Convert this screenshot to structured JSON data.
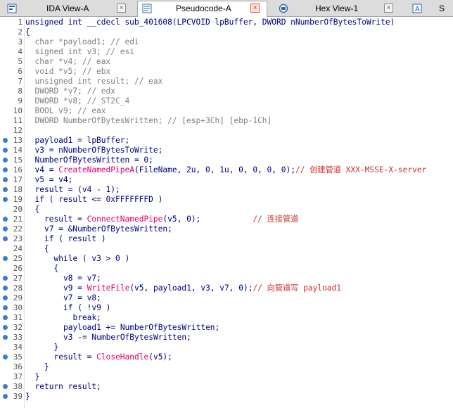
{
  "tabs": [
    {
      "label": "IDA View-A",
      "icon": "ida-view-icon",
      "active": false
    },
    {
      "label": "Pseudocode-A",
      "icon": "pseudocode-icon",
      "active": true
    },
    {
      "label": "Hex View-1",
      "icon": "hex-view-icon",
      "active": false
    },
    {
      "label": "S",
      "icon": "structures-icon",
      "active": false
    }
  ],
  "close_glyph": "×",
  "code_lines": [
    {
      "n": "1",
      "dot": false,
      "indent": 0,
      "segs": [
        {
          "t": "unsigned int __cdecl sub_401608(LPCVOID lpBuffer, DWORD nNumberOfBytesToWrite)",
          "c": "n"
        }
      ]
    },
    {
      "n": "2",
      "dot": false,
      "indent": 0,
      "segs": [
        {
          "t": "{",
          "c": "n"
        }
      ]
    },
    {
      "n": "3",
      "dot": false,
      "indent": 2,
      "segs": [
        {
          "t": "char *payload1; // edi",
          "c": "c"
        }
      ]
    },
    {
      "n": "4",
      "dot": false,
      "indent": 2,
      "segs": [
        {
          "t": "signed int v3; // esi",
          "c": "c"
        }
      ]
    },
    {
      "n": "5",
      "dot": false,
      "indent": 2,
      "segs": [
        {
          "t": "char *v4; // eax",
          "c": "c"
        }
      ]
    },
    {
      "n": "6",
      "dot": false,
      "indent": 2,
      "segs": [
        {
          "t": "void *v5; // ebx",
          "c": "c"
        }
      ]
    },
    {
      "n": "7",
      "dot": false,
      "indent": 2,
      "segs": [
        {
          "t": "unsigned int result; // eax",
          "c": "c"
        }
      ]
    },
    {
      "n": "8",
      "dot": false,
      "indent": 2,
      "segs": [
        {
          "t": "DWORD *v7; // edx",
          "c": "c"
        }
      ]
    },
    {
      "n": "9",
      "dot": false,
      "indent": 2,
      "segs": [
        {
          "t": "DWORD *v8; // ST2C_4",
          "c": "c"
        }
      ]
    },
    {
      "n": "10",
      "dot": false,
      "indent": 2,
      "segs": [
        {
          "t": "BOOL v9; // eax",
          "c": "c"
        }
      ]
    },
    {
      "n": "11",
      "dot": false,
      "indent": 2,
      "segs": [
        {
          "t": "DWORD NumberOfBytesWritten; // [esp+3Ch] [ebp-1Ch]",
          "c": "c"
        }
      ]
    },
    {
      "n": "12",
      "dot": false,
      "indent": 0,
      "segs": []
    },
    {
      "n": "13",
      "dot": true,
      "indent": 2,
      "segs": [
        {
          "t": "payload1 = lpBuffer;",
          "c": "n"
        }
      ]
    },
    {
      "n": "14",
      "dot": true,
      "indent": 2,
      "segs": [
        {
          "t": "v3 = nNumberOfBytesToWrite;",
          "c": "n"
        }
      ]
    },
    {
      "n": "15",
      "dot": true,
      "indent": 2,
      "segs": [
        {
          "t": "NumberOfBytesWritten = 0;",
          "c": "n"
        }
      ]
    },
    {
      "n": "16",
      "dot": true,
      "indent": 2,
      "segs": [
        {
          "t": "v4 = ",
          "c": "n"
        },
        {
          "t": "CreateNamedPipeA",
          "c": "f"
        },
        {
          "t": "(FileName, 2u, 0, 1u, 0, 0, 0, 0);",
          "c": "n"
        },
        {
          "t": "// 创建管道 XXX-MSSE-X-server",
          "c": "cm"
        }
      ]
    },
    {
      "n": "17",
      "dot": true,
      "indent": 2,
      "segs": [
        {
          "t": "v5 = v4;",
          "c": "n"
        }
      ]
    },
    {
      "n": "18",
      "dot": true,
      "indent": 2,
      "segs": [
        {
          "t": "result = (v4 - 1);",
          "c": "n"
        }
      ]
    },
    {
      "n": "19",
      "dot": true,
      "indent": 2,
      "segs": [
        {
          "t": "if ( result <= 0xFFFFFFFD )",
          "c": "n"
        }
      ]
    },
    {
      "n": "20",
      "dot": false,
      "indent": 2,
      "segs": [
        {
          "t": "{",
          "c": "n"
        }
      ]
    },
    {
      "n": "21",
      "dot": true,
      "indent": 4,
      "segs": [
        {
          "t": "result = ",
          "c": "n"
        },
        {
          "t": "ConnectNamedPipe",
          "c": "f"
        },
        {
          "t": "(v5, 0);           ",
          "c": "n"
        },
        {
          "t": "// 连接管道",
          "c": "cm"
        }
      ]
    },
    {
      "n": "22",
      "dot": true,
      "indent": 4,
      "segs": [
        {
          "t": "v7 = &NumberOfBytesWritten;",
          "c": "n"
        }
      ]
    },
    {
      "n": "23",
      "dot": true,
      "indent": 4,
      "segs": [
        {
          "t": "if ( result )",
          "c": "n"
        }
      ]
    },
    {
      "n": "24",
      "dot": false,
      "indent": 4,
      "segs": [
        {
          "t": "{",
          "c": "n"
        }
      ]
    },
    {
      "n": "25",
      "dot": true,
      "indent": 6,
      "segs": [
        {
          "t": "while ( v3 > 0 )",
          "c": "n"
        }
      ]
    },
    {
      "n": "26",
      "dot": false,
      "indent": 6,
      "segs": [
        {
          "t": "{",
          "c": "n"
        }
      ]
    },
    {
      "n": "27",
      "dot": true,
      "indent": 8,
      "segs": [
        {
          "t": "v8 = v7;",
          "c": "n"
        }
      ]
    },
    {
      "n": "28",
      "dot": true,
      "indent": 8,
      "segs": [
        {
          "t": "v9 = ",
          "c": "n"
        },
        {
          "t": "WriteFile",
          "c": "f"
        },
        {
          "t": "(v5, payload1, v3, v7, 0);",
          "c": "n"
        },
        {
          "t": "// 向管道写 payload1",
          "c": "cm"
        }
      ]
    },
    {
      "n": "29",
      "dot": true,
      "indent": 8,
      "segs": [
        {
          "t": "v7 = v8;",
          "c": "n"
        }
      ]
    },
    {
      "n": "30",
      "dot": true,
      "indent": 8,
      "segs": [
        {
          "t": "if ( !v9 )",
          "c": "n"
        }
      ]
    },
    {
      "n": "31",
      "dot": true,
      "indent": 10,
      "segs": [
        {
          "t": "break;",
          "c": "n"
        }
      ]
    },
    {
      "n": "32",
      "dot": true,
      "indent": 8,
      "segs": [
        {
          "t": "payload1 += NumberOfBytesWritten;",
          "c": "n"
        }
      ]
    },
    {
      "n": "33",
      "dot": true,
      "indent": 8,
      "segs": [
        {
          "t": "v3 -= NumberOfBytesWritten;",
          "c": "n"
        }
      ]
    },
    {
      "n": "34",
      "dot": false,
      "indent": 6,
      "segs": [
        {
          "t": "}",
          "c": "n"
        }
      ]
    },
    {
      "n": "35",
      "dot": true,
      "indent": 6,
      "segs": [
        {
          "t": "result = ",
          "c": "n"
        },
        {
          "t": "CloseHandle",
          "c": "f"
        },
        {
          "t": "(v5);",
          "c": "n"
        }
      ]
    },
    {
      "n": "36",
      "dot": false,
      "indent": 4,
      "segs": [
        {
          "t": "}",
          "c": "n"
        }
      ]
    },
    {
      "n": "37",
      "dot": false,
      "indent": 2,
      "segs": [
        {
          "t": "}",
          "c": "n"
        }
      ]
    },
    {
      "n": "38",
      "dot": true,
      "indent": 2,
      "segs": [
        {
          "t": "return result;",
          "c": "n"
        }
      ]
    },
    {
      "n": "39",
      "dot": true,
      "indent": 0,
      "segs": [
        {
          "t": "}",
          "c": "n"
        }
      ]
    }
  ],
  "colors": {
    "text": "#000080",
    "comment_gray": "#808080",
    "comment_red": "#d03030",
    "func": "#e0006e",
    "breakpoint_dot": "#3a7bd5"
  }
}
